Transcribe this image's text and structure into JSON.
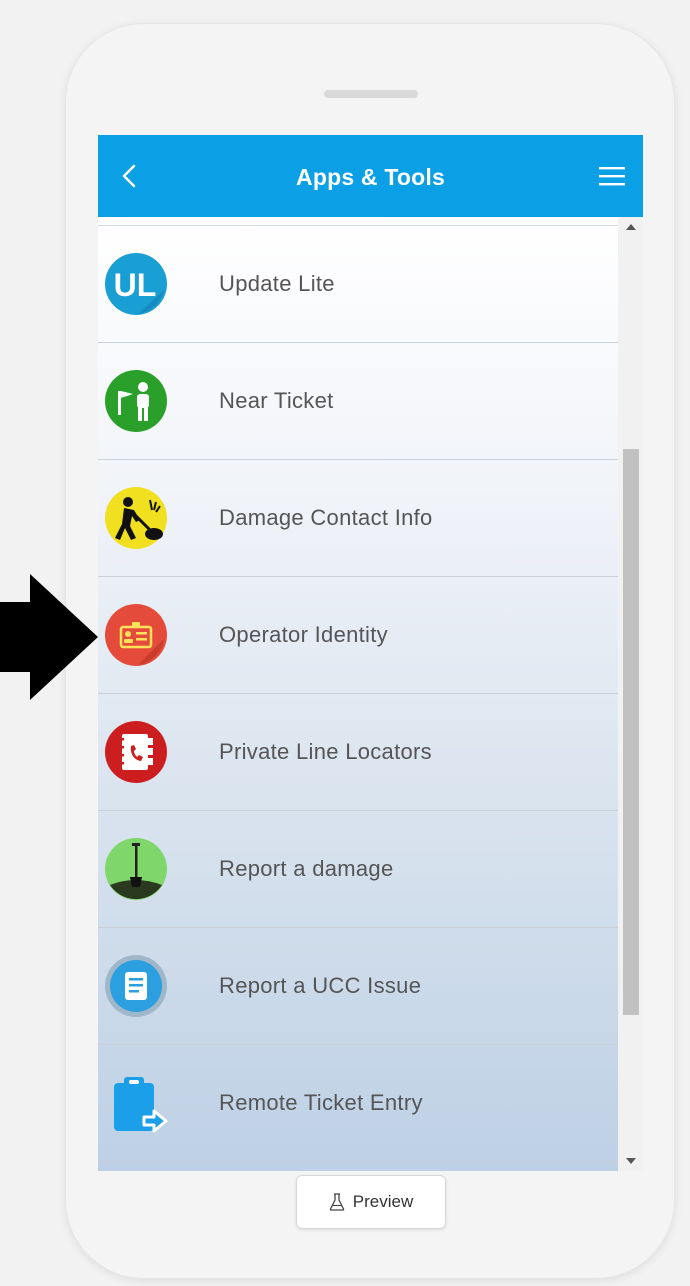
{
  "header": {
    "title": "Apps & Tools"
  },
  "items": [
    {
      "label": "Update Lite",
      "icon": "update-lite-icon",
      "color": "#1a9fd5"
    },
    {
      "label": "Near Ticket",
      "icon": "near-ticket-icon",
      "color": "#2aa02a"
    },
    {
      "label": "Damage Contact Info",
      "icon": "damage-contact-icon",
      "color": "#f0e020"
    },
    {
      "label": "Operator Identity",
      "icon": "operator-identity-icon",
      "color": "#e54b3a"
    },
    {
      "label": "Private Line Locators",
      "icon": "private-line-icon",
      "color": "#cc1e1e"
    },
    {
      "label": "Report a damage",
      "icon": "report-damage-icon",
      "color": "#7fd66a"
    },
    {
      "label": "Report a UCC Issue",
      "icon": "report-ucc-icon",
      "color": "#2b9fe0"
    },
    {
      "label": "Remote Ticket Entry",
      "icon": "remote-ticket-icon",
      "color": "#1a9fe8"
    }
  ],
  "footer": {
    "preview_label": "Preview"
  },
  "colors": {
    "header": "#0ba0e6",
    "arrow": "#000000"
  }
}
